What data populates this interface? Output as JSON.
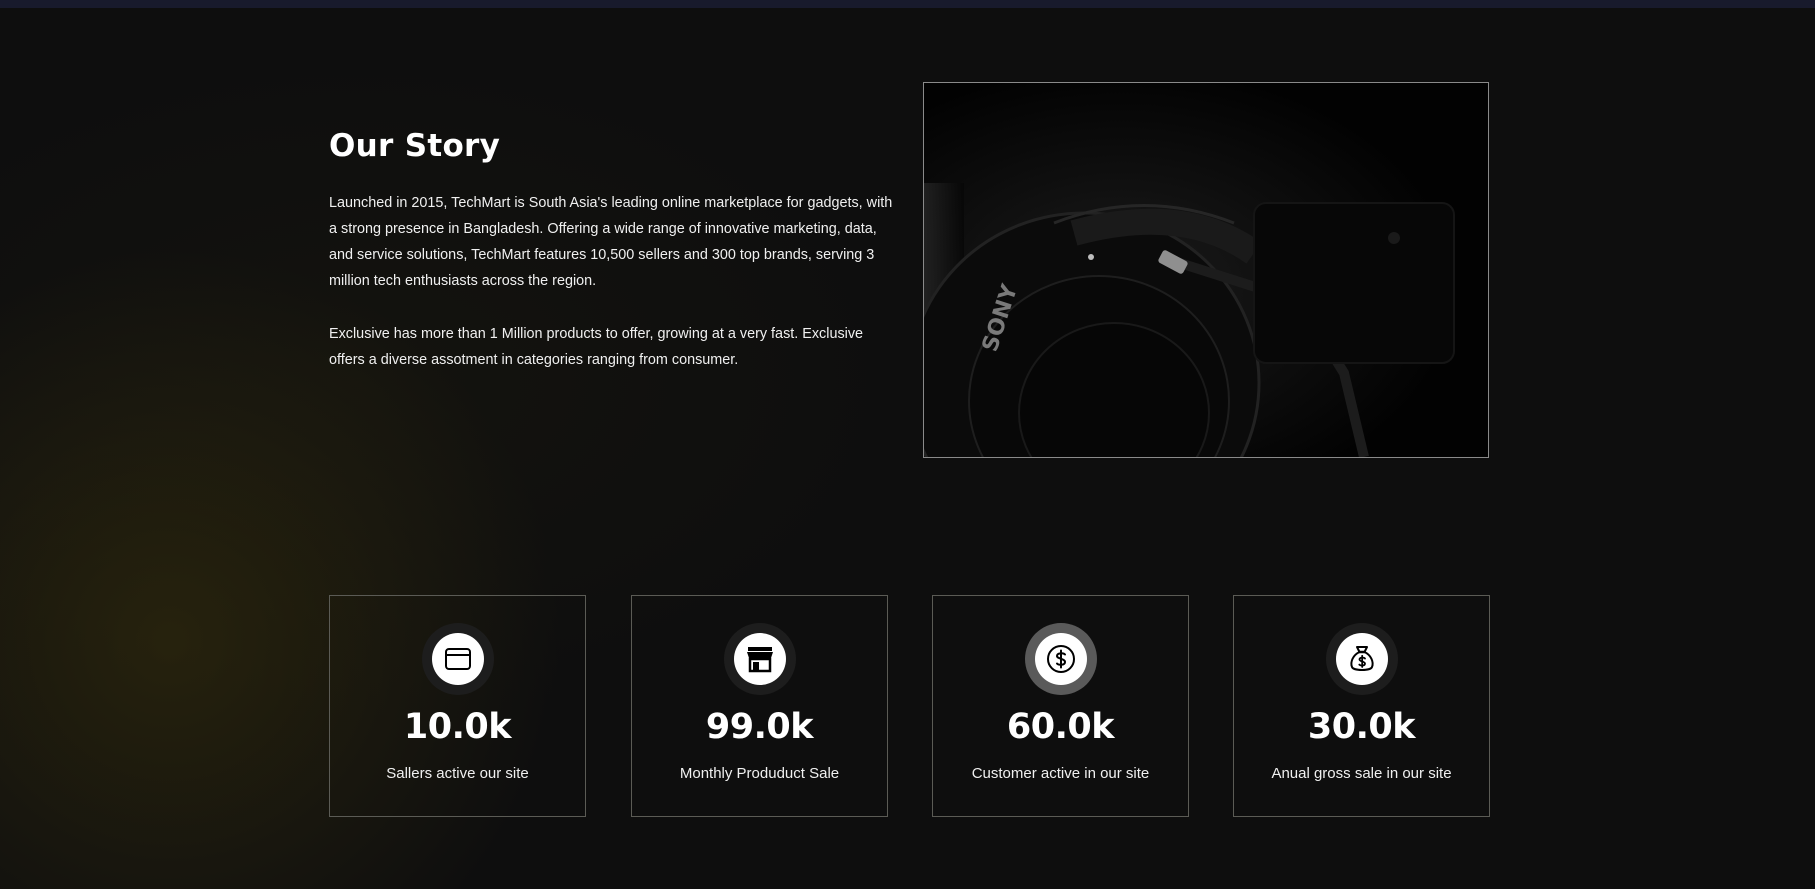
{
  "story": {
    "title": "Our Story",
    "paragraph_1": "Launched in 2015, TechMart is South Asia's leading online marketplace for gadgets, with a strong presence in Bangladesh. Offering a wide range of innovative marketing, data, and service solutions, TechMart features 10,500 sellers and 300 top brands, serving 3 million tech enthusiasts across the region.",
    "paragraph_2": "Exclusive has more than 1 Million products to offer, growing at a very fast. Exclusive offers a diverse assotment in categories ranging from consumer.",
    "image_icon": "headphones-photo",
    "image_brand_text": "SONY"
  },
  "stats": [
    {
      "value": "10.0k",
      "label": "Sallers active our site",
      "icon": "shop-window-icon",
      "highlighted": false
    },
    {
      "value": "99.0k",
      "label": "Monthly Produduct Sale",
      "icon": "storefront-icon",
      "highlighted": false
    },
    {
      "value": "60.0k",
      "label": "Customer active in our site",
      "icon": "dollar-coin-icon",
      "highlighted": true
    },
    {
      "value": "30.0k",
      "label": "Anual gross sale in our site",
      "icon": "money-bag-icon",
      "highlighted": false
    }
  ],
  "colors": {
    "background": "#0e0e0e",
    "text": "#ffffff",
    "card_border": "#5b5b55",
    "icon_ring": "#1d1d1d",
    "icon_ring_active": "#5a5a5a"
  }
}
